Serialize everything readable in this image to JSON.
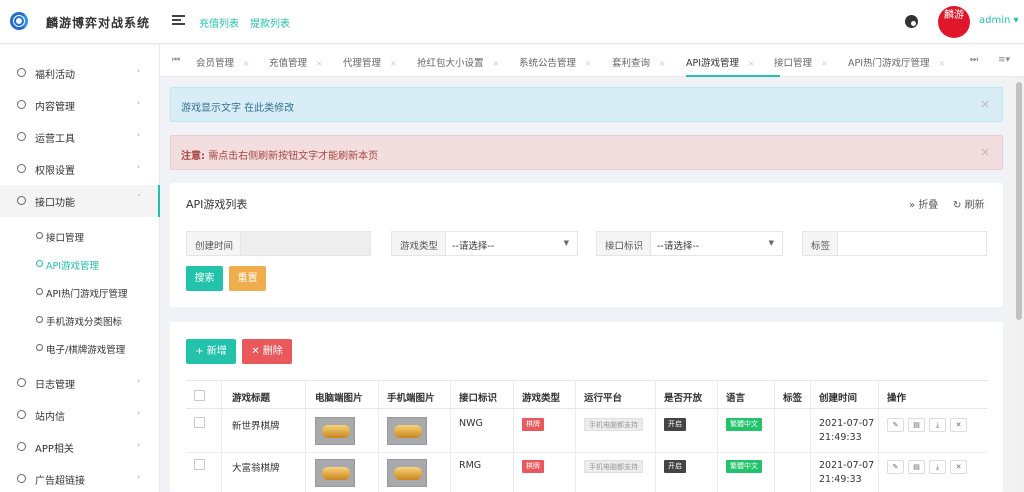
{
  "header": {
    "app_title": "麟游博弈对战系统",
    "links": [
      "充值列表",
      "提款列表"
    ],
    "avatar_text": "麟游",
    "user": "admin ▾"
  },
  "sidebar": {
    "items": [
      {
        "label": "福利活动"
      },
      {
        "label": "内容管理"
      },
      {
        "label": "运营工具"
      },
      {
        "label": "权限设置"
      },
      {
        "label": "接口功能"
      }
    ],
    "subitems": [
      {
        "label": "接口管理"
      },
      {
        "label": "API游戏管理"
      },
      {
        "label": "API热门游戏厅管理"
      },
      {
        "label": "手机游戏分类图标"
      },
      {
        "label": "电子/棋牌游戏管理"
      }
    ],
    "items_after": [
      {
        "label": "日志管理"
      },
      {
        "label": "站内信"
      },
      {
        "label": "APP相关"
      },
      {
        "label": "广告超链接"
      }
    ]
  },
  "tabs": [
    "会员管理",
    "充值管理",
    "代理管理",
    "抢红包大小设置",
    "系统公告管理",
    "套利查询",
    "API游戏管理",
    "接口管理",
    "API热门游戏厅管理"
  ],
  "alerts": {
    "info": "游戏显示文字 在此类修改",
    "danger_prefix": "注意:",
    "danger_text": "需点击右侧刷新按钮文字才能刷新本页"
  },
  "search": {
    "title": "API游戏列表",
    "fold": "折叠",
    "refresh": "刷新",
    "created_label": "创建时间",
    "type_label": "游戏类型",
    "type_value": "--请选择--",
    "iface_label": "接口标识",
    "iface_value": "--请选择--",
    "tag_label": "标签",
    "search_btn": "搜索",
    "reset_btn": "重置"
  },
  "toolbar": {
    "add": "新增",
    "delete": "删除"
  },
  "table": {
    "headers": [
      "游戏标题",
      "电脑端图片",
      "手机端图片",
      "接口标识",
      "游戏类型",
      "运行平台",
      "是否开放",
      "语言",
      "标签",
      "创建时间",
      "操作"
    ],
    "rows": [
      {
        "title": "新世界棋牌",
        "iface": "NWG",
        "type": "棋牌",
        "platform": "手机电脑都支持",
        "open": "开启",
        "lang": "繁體中文",
        "date": "2021-07-07",
        "time": "21:49:33"
      },
      {
        "title": "大富翁棋牌",
        "iface": "RMG",
        "type": "棋牌",
        "platform": "手机电脑都支持",
        "open": "开启",
        "lang": "繁體中文",
        "date": "2021-07-07",
        "time": "21:49:33"
      }
    ]
  }
}
